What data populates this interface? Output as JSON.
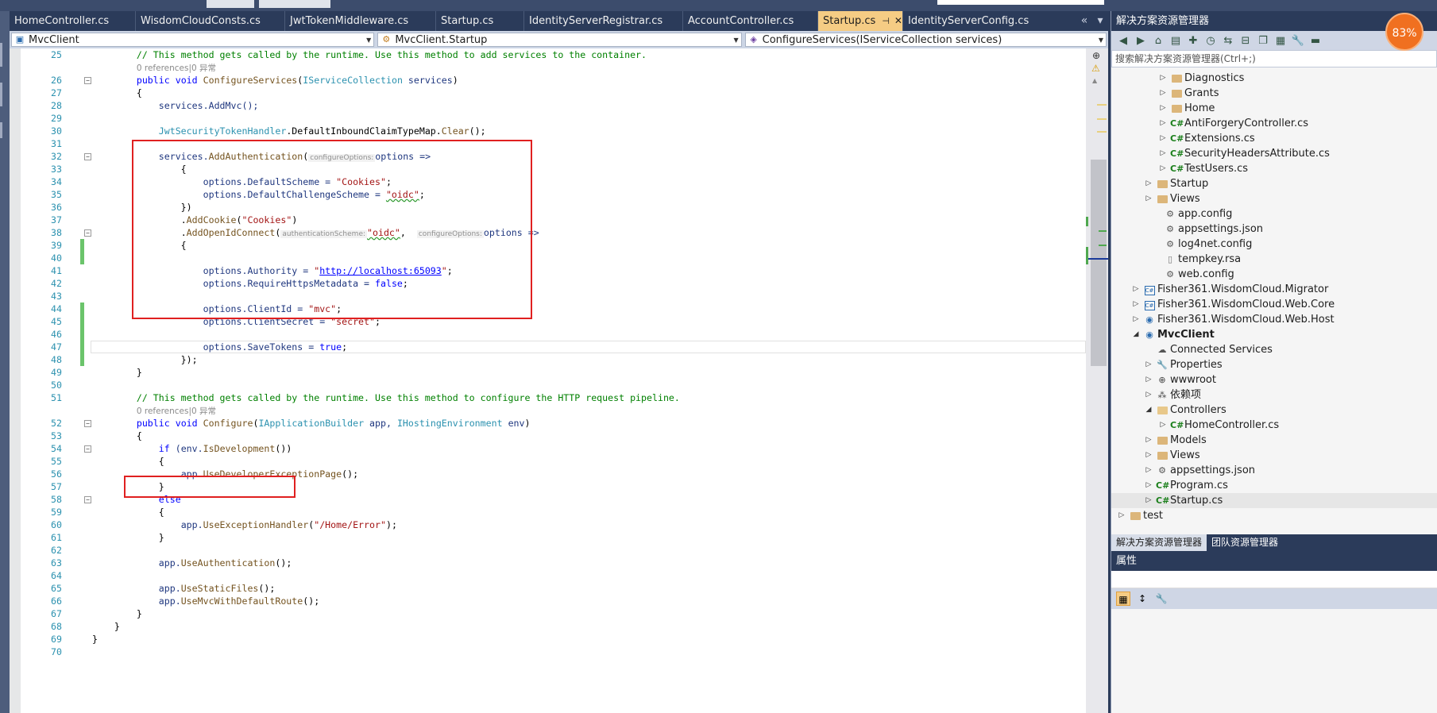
{
  "tabs": [
    {
      "label": "HomeController.cs",
      "active": false
    },
    {
      "label": "WisdomCloudConsts.cs",
      "active": false
    },
    {
      "label": "JwtTokenMiddleware.cs",
      "active": false
    },
    {
      "label": "Startup.cs",
      "active": false
    },
    {
      "label": "IdentityServerRegistrar.cs",
      "active": false
    },
    {
      "label": "AccountController.cs",
      "active": false
    },
    {
      "label": "Startup.cs",
      "active": true
    },
    {
      "label": "IdentityServerConfig.cs",
      "active": false
    }
  ],
  "tab_controls": {
    "overflow": "«",
    "dropdown": "▾"
  },
  "navbar": {
    "project": "MvcClient",
    "type": "MvcClient.Startup",
    "member": "ConfigureServices(IServiceCollection services)"
  },
  "solution_explorer": {
    "title": "解决方案资源管理器",
    "search_placeholder": "搜索解决方案资源管理器(Ctrl+;)",
    "items": [
      {
        "label": "Diagnostics",
        "kind": "folder"
      },
      {
        "label": "Grants",
        "kind": "folder"
      },
      {
        "label": "Home",
        "kind": "folder"
      },
      {
        "label": "AntiForgeryController.cs",
        "kind": "cs"
      },
      {
        "label": "Extensions.cs",
        "kind": "cs"
      },
      {
        "label": "SecurityHeadersAttribute.cs",
        "kind": "cs"
      },
      {
        "label": "TestUsers.cs",
        "kind": "cs"
      },
      {
        "label": "Startup",
        "kind": "folder"
      },
      {
        "label": "Views",
        "kind": "folder"
      },
      {
        "label": "app.config",
        "kind": "config"
      },
      {
        "label": "appsettings.json",
        "kind": "config"
      },
      {
        "label": "log4net.config",
        "kind": "config"
      },
      {
        "label": "tempkey.rsa",
        "kind": "file"
      },
      {
        "label": "web.config",
        "kind": "config"
      },
      {
        "label": "Fisher361.WisdomCloud.Migrator",
        "kind": "project"
      },
      {
        "label": "Fisher361.WisdomCloud.Web.Core",
        "kind": "project"
      },
      {
        "label": "Fisher361.WisdomCloud.Web.Host",
        "kind": "webproject"
      },
      {
        "label": "MvcClient",
        "kind": "webproject"
      },
      {
        "label": "Connected Services",
        "kind": "service"
      },
      {
        "label": "Properties",
        "kind": "wrench"
      },
      {
        "label": "wwwroot",
        "kind": "globe"
      },
      {
        "label": "依赖项",
        "kind": "deps"
      },
      {
        "label": "Controllers",
        "kind": "folder-open"
      },
      {
        "label": "HomeController.cs",
        "kind": "cs"
      },
      {
        "label": "Models",
        "kind": "folder"
      },
      {
        "label": "Views",
        "kind": "folder"
      },
      {
        "label": "appsettings.json",
        "kind": "config"
      },
      {
        "label": "Program.cs",
        "kind": "cs"
      },
      {
        "label": "Startup.cs",
        "kind": "cs"
      },
      {
        "label": "test",
        "kind": "folder"
      }
    ],
    "bottom_tabs": [
      "解决方案资源管理器",
      "团队资源管理器"
    ]
  },
  "properties": {
    "title": "属性"
  },
  "badge": {
    "label": "83%"
  },
  "code": {
    "l25": "// This method gets called by the runtime. Use this method to add services to the container.",
    "r26": "0 references|0 异常",
    "l26a": "public",
    "l26b": "void",
    "l26c": "ConfigureServices",
    "l26d": "IServiceCollection",
    "l26e": "services",
    "l28": "services.AddMvc();",
    "l30a": "JwtSecurityTokenHandler",
    "l30b": ".DefaultInboundClaimTypeMap.",
    "l30c": "Clear",
    "l30d": "();",
    "l32a": "services.",
    "l32b": "AddAuthentication",
    "l32h": "configureOptions:",
    "l32c": "options =>",
    "l34a": "options.DefaultScheme = ",
    "l34b": "\"Cookies\"",
    "l35a": "options.DefaultChallengeScheme = ",
    "l35b": "\"oidc\"",
    "l37a": ".",
    "l37b": "AddCookie",
    "l37c": "\"Cookies\"",
    "l38a": ".",
    "l38b": "AddOpenIdConnect",
    "l38h1": "authenticationScheme:",
    "l38c": "\"oidc\"",
    "l38h2": "configureOptions:",
    "l38d": "options =>",
    "l41a": "options.Authority = ",
    "l41b": "\"",
    "l41c": "http://localhost:65093",
    "l41d": "\"",
    "l42a": "options.RequireHttpsMetadata = ",
    "l42b": "false",
    "l44a": "options.ClientId = ",
    "l44b": "\"mvc\"",
    "l45a": "options.ClientSecret = ",
    "l45b": "\"secret\"",
    "l47a": "options.SaveTokens = ",
    "l47b": "true",
    "l51": "// This method gets called by the runtime. Use this method to configure the HTTP request pipeline.",
    "r52": "0 references|0 异常",
    "l52a": "public",
    "l52b": "void",
    "l52c": "Configure",
    "l52d": "IApplicationBuilder",
    "l52e": "app,",
    "l52f": "IHostingEnvironment",
    "l52g": "env",
    "l54a": "if",
    "l54b": "(env.",
    "l54c": "IsDevelopment",
    "l54d": "())",
    "l56a": "app.",
    "l56b": "UseDeveloperExceptionPage",
    "l56c": "();",
    "l58": "else",
    "l60a": "app.",
    "l60b": "UseExceptionHandler",
    "l60c": "\"/Home/Error\"",
    "l63a": "app.",
    "l63b": "UseAuthentication",
    "l63c": "();",
    "l65a": "app.",
    "l65b": "UseStaticFiles",
    "l65c": "();",
    "l66a": "app.",
    "l66b": "UseMvcWithDefaultRoute",
    "l66c": "();"
  }
}
